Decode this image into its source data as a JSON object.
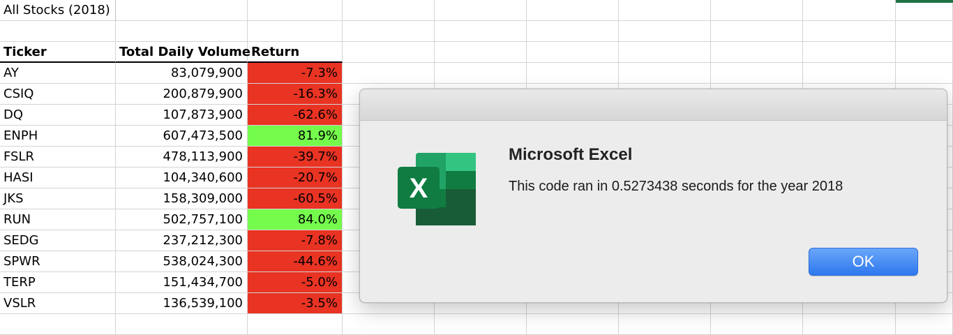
{
  "sheet": {
    "title": "All Stocks (2018)",
    "headers": [
      "Ticker",
      "Total Daily Volume",
      "Return"
    ],
    "rows": [
      {
        "ticker": "AY",
        "volume": "83,079,900",
        "ret": "-7.3%",
        "status": "negative"
      },
      {
        "ticker": "CSIQ",
        "volume": "200,879,900",
        "ret": "-16.3%",
        "status": "negative"
      },
      {
        "ticker": "DQ",
        "volume": "107,873,900",
        "ret": "-62.6%",
        "status": "negative"
      },
      {
        "ticker": "ENPH",
        "volume": "607,473,500",
        "ret": "81.9%",
        "status": "positive"
      },
      {
        "ticker": "FSLR",
        "volume": "478,113,900",
        "ret": "-39.7%",
        "status": "negative"
      },
      {
        "ticker": "HASI",
        "volume": "104,340,600",
        "ret": "-20.7%",
        "status": "negative"
      },
      {
        "ticker": "JKS",
        "volume": "158,309,000",
        "ret": "-60.5%",
        "status": "negative"
      },
      {
        "ticker": "RUN",
        "volume": "502,757,100",
        "ret": "84.0%",
        "status": "positive"
      },
      {
        "ticker": "SEDG",
        "volume": "237,212,300",
        "ret": "-7.8%",
        "status": "negative"
      },
      {
        "ticker": "SPWR",
        "volume": "538,024,300",
        "ret": "-44.6%",
        "status": "negative"
      },
      {
        "ticker": "TERP",
        "volume": "151,434,700",
        "ret": "-5.0%",
        "status": "negative"
      },
      {
        "ticker": "VSLR",
        "volume": "136,539,100",
        "ret": "-3.5%",
        "status": "negative"
      }
    ],
    "colors": {
      "negative": "#e93323",
      "positive": "#75fb4c",
      "selection": "#1e7145"
    }
  },
  "dialog": {
    "icon": "excel-icon",
    "title": "Microsoft Excel",
    "message": "This code ran in 0.5273438 seconds for the year 2018",
    "ok_label": "OK"
  }
}
